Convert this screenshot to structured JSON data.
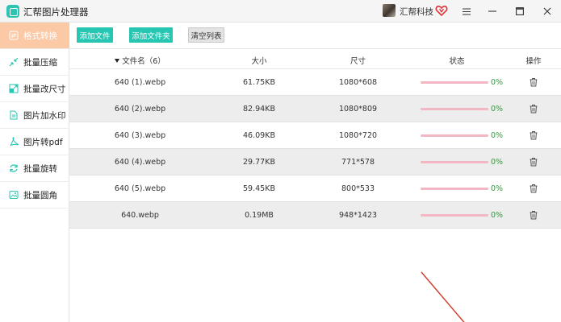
{
  "app": {
    "title": "汇帮图片处理器"
  },
  "user": {
    "name": "汇帮科技"
  },
  "window": {
    "menu_icon": "hamburger-icon",
    "minimize_icon": "minimize-icon",
    "maximize_icon": "maximize-icon",
    "close_icon": "close-icon"
  },
  "sidebar": {
    "items": [
      {
        "label": "格式转换",
        "icon": "format-convert-icon",
        "active": true
      },
      {
        "label": "批量压缩",
        "icon": "compress-icon",
        "active": false
      },
      {
        "label": "批量改尺寸",
        "icon": "resize-icon",
        "active": false
      },
      {
        "label": "图片加水印",
        "icon": "watermark-icon",
        "active": false
      },
      {
        "label": "图片转pdf",
        "icon": "pdf-icon",
        "active": false
      },
      {
        "label": "批量旋转",
        "icon": "rotate-icon",
        "active": false
      },
      {
        "label": "批量圆角",
        "icon": "rounded-corner-icon",
        "active": false
      }
    ]
  },
  "toolbar": {
    "add_file": "添加文件",
    "add_folder": "添加文件夹",
    "clear_list": "清空列表"
  },
  "table": {
    "headers": {
      "name": "文件名（6）",
      "size": "大小",
      "dimensions": "尺寸",
      "status": "状态",
      "action": "操作"
    },
    "rows": [
      {
        "name": "640 (1).webp",
        "size": "61.75KB",
        "dimensions": "1080*608",
        "progress": 0,
        "percent": "0%"
      },
      {
        "name": "640 (2).webp",
        "size": "82.94KB",
        "dimensions": "1080*809",
        "progress": 0,
        "percent": "0%"
      },
      {
        "name": "640 (3).webp",
        "size": "46.09KB",
        "dimensions": "1080*720",
        "progress": 0,
        "percent": "0%"
      },
      {
        "name": "640 (4).webp",
        "size": "29.77KB",
        "dimensions": "771*578",
        "progress": 0,
        "percent": "0%"
      },
      {
        "name": "640 (5).webp",
        "size": "59.45KB",
        "dimensions": "800*533",
        "progress": 0,
        "percent": "0%"
      },
      {
        "name": "640.webp",
        "size": "0.19MB",
        "dimensions": "948*1423",
        "progress": 0,
        "percent": "0%"
      }
    ]
  },
  "colors": {
    "accent": "#26c6b2",
    "active_sidebar": "#fbc9a6",
    "progress_track": "#f3b7c3",
    "percent_text": "#2e9e3c",
    "vip": "#e0333a"
  }
}
